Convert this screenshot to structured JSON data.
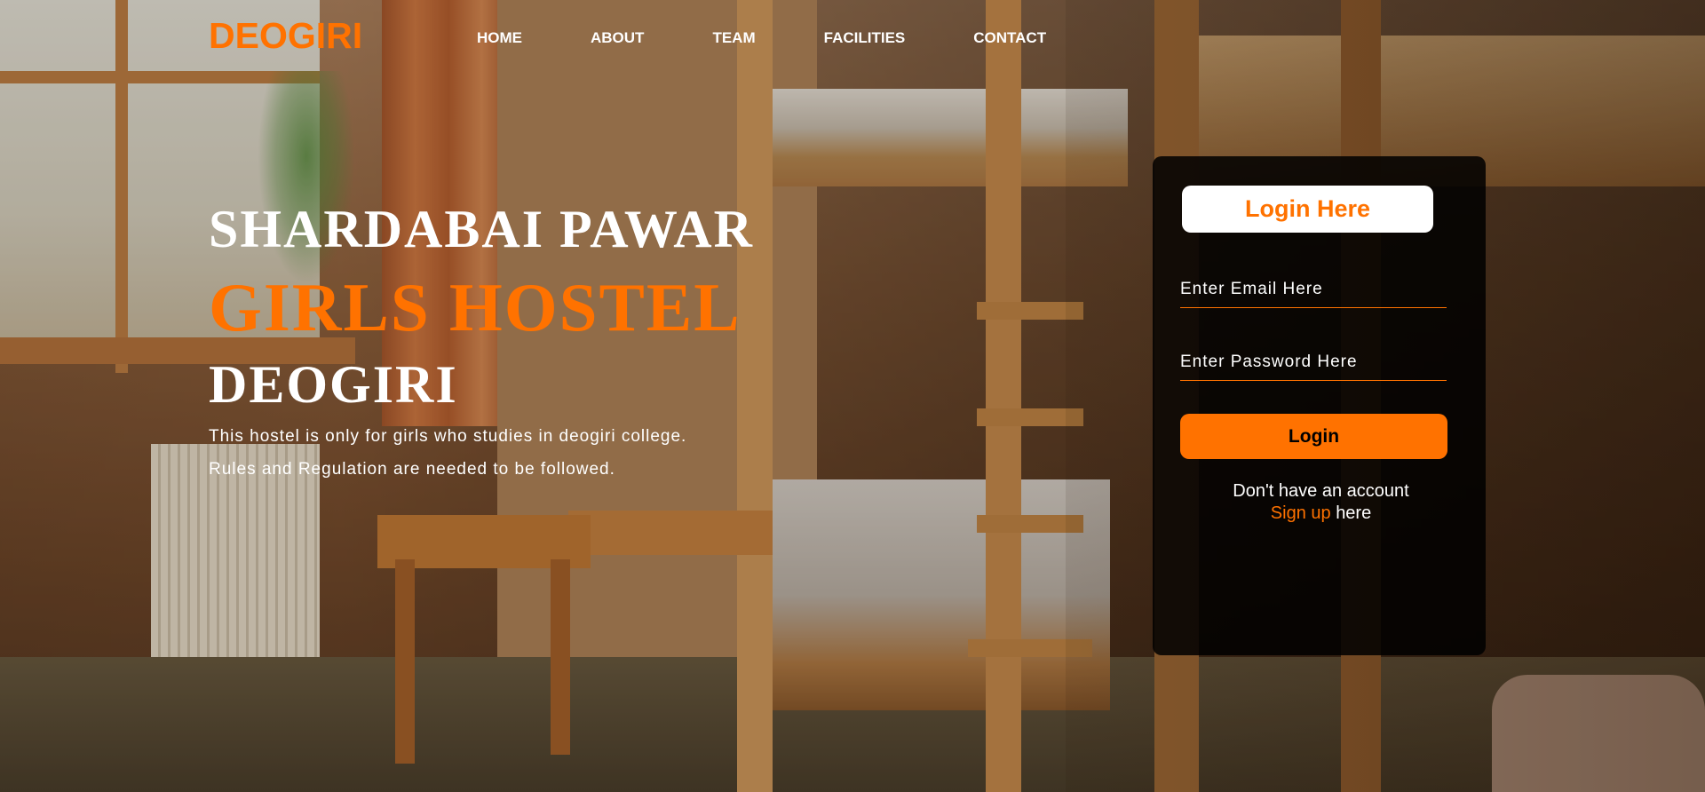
{
  "brand": {
    "logo": "DEOGIRI",
    "accent_color": "#ff7200"
  },
  "nav": {
    "items": [
      {
        "label": "HOME"
      },
      {
        "label": "ABOUT"
      },
      {
        "label": "TEAM"
      },
      {
        "label": "FACILITIES"
      },
      {
        "label": "CONTACT"
      }
    ]
  },
  "hero": {
    "line1": "SHARDABAI PAWAR",
    "line2": "GIRLS HOSTEL",
    "line3": "DEOGIRI",
    "description": "This hostel is only for girls who studies in deogiri college.",
    "rules": "Rules and Regulation are needed to be followed."
  },
  "login": {
    "title": "Login Here",
    "email_placeholder": "Enter Email Here",
    "password_placeholder": "Enter Password Here",
    "button_label": "Login",
    "no_account_text": "Don't have an account",
    "signup_link": "Sign up",
    "signup_suffix": "here"
  }
}
